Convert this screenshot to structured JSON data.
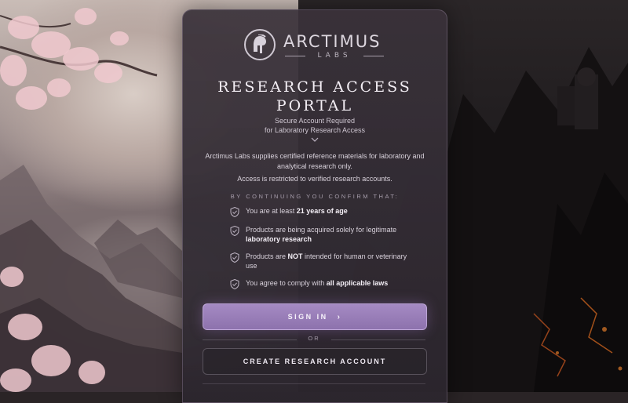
{
  "brand": {
    "name": "ARCTIMUS",
    "sub": "LABS"
  },
  "portal": {
    "title_line1": "RESEARCH ACCESS",
    "title_line2": "PORTAL",
    "subtitle_line1": "Secure Account Required",
    "subtitle_line2": "for Laboratory Research Access",
    "description": "Arctimus Labs supplies certified reference materials for laboratory and analytical research only.",
    "restriction": "Access is restricted to verified research accounts.",
    "confirm_heading": "BY CONTINUING YOU CONFIRM THAT:"
  },
  "confirmations": [
    {
      "pre": "You are at least ",
      "bold": "21 years of age",
      "post": ""
    },
    {
      "pre": "Products are being acquired solely for legitimate ",
      "bold": "laboratory research",
      "post": ""
    },
    {
      "pre": "Products are ",
      "bold": "NOT",
      "post": " intended for human or veterinary use"
    },
    {
      "pre": "You agree to comply with ",
      "bold": "all applicable laws",
      "post": ""
    }
  ],
  "actions": {
    "sign_in_label": "SIGN IN",
    "sign_in_arrow": "›",
    "or_label": "OR",
    "create_account_label": "CREATE RESEARCH ACCOUNT"
  },
  "icons": {
    "logo": "spartan-helmet-icon",
    "chevron": "chevron-down-icon",
    "check": "shield-check-icon"
  },
  "colors": {
    "accent": "#9b7fbb",
    "panel": "#3a323a"
  }
}
